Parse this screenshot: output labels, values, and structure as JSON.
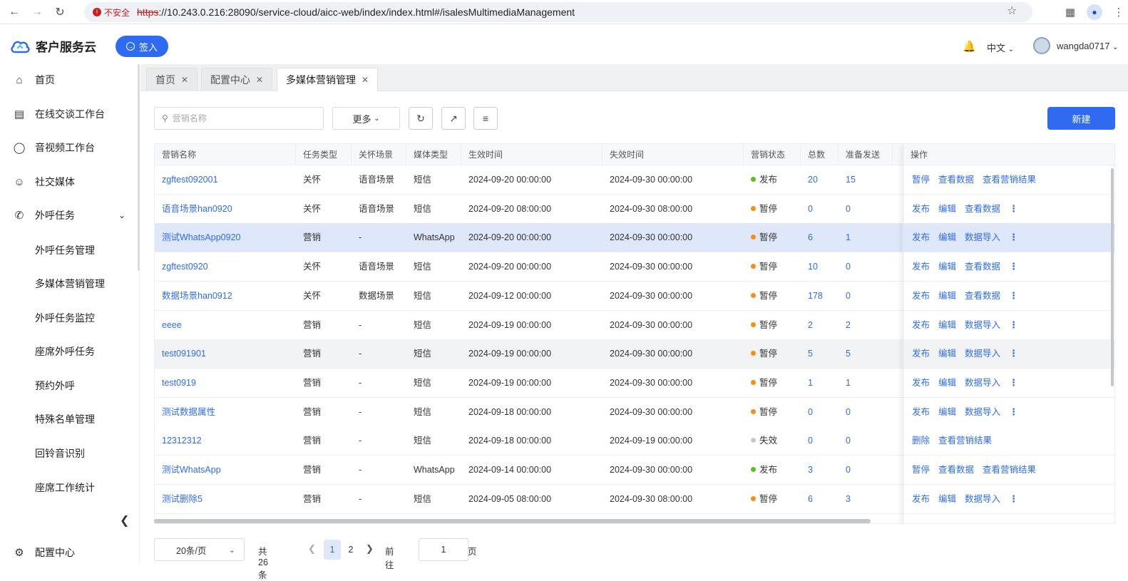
{
  "browser": {
    "insecure_label": "不安全",
    "url_scheme": "https",
    "url_rest": "://10.243.0.216:28090/service-cloud/aicc-web/index/index.html#/isalesMultimediaManagement"
  },
  "header": {
    "app_name": "客户服务云",
    "signin_label": "签入",
    "language": "中文",
    "username": "wangda0717"
  },
  "sidebar": {
    "items": [
      {
        "label": "首页",
        "icon": "home-icon"
      },
      {
        "label": "在线交谈工作台",
        "icon": "chat-icon"
      },
      {
        "label": "音视频工作台",
        "icon": "headset-icon"
      },
      {
        "label": "社交媒体",
        "icon": "social-icon"
      },
      {
        "label": "外呼任务",
        "icon": "phone-icon"
      }
    ],
    "sub_items": [
      "外呼任务管理",
      "多媒体营销管理",
      "外呼任务监控",
      "座席外呼任务",
      "预约外呼",
      "特殊名单管理",
      "回铃音识别",
      "座席工作统计"
    ],
    "bottom_item": "配置中心"
  },
  "tabs": [
    {
      "label": "首页"
    },
    {
      "label": "配置中心"
    },
    {
      "label": "多媒体营销管理"
    }
  ],
  "toolbar": {
    "search_placeholder": "营销名称",
    "more_label": "更多",
    "new_label": "新建"
  },
  "table": {
    "headers": [
      "营销名称",
      "任务类型",
      "关怀场景",
      "媒体类型",
      "生效时间",
      "失效时间",
      "营销状态",
      "总数",
      "准备发送",
      "操作"
    ],
    "rows": [
      {
        "name": "zgftest092001",
        "type": "关怀",
        "scene": "语音场景",
        "media": "短信",
        "start": "2024-09-20 00:00:00",
        "end": "2024-09-30 00:00:00",
        "status": "发布",
        "status_color": "#52c41a",
        "total": "20",
        "ready": "15",
        "ops": [
          "暂停",
          "查看数据",
          "查看营销结果"
        ],
        "more": false
      },
      {
        "name": "语音场景han0920",
        "type": "关怀",
        "scene": "语音场景",
        "media": "短信",
        "start": "2024-09-20 08:00:00",
        "end": "2024-09-30 08:00:00",
        "status": "暂停",
        "status_color": "#fa8c16",
        "total": "0",
        "ready": "0",
        "ops": [
          "发布",
          "编辑",
          "查看数据"
        ],
        "more": true
      },
      {
        "name": "测试WhatsApp0920",
        "type": "营销",
        "scene": "-",
        "media": "WhatsApp",
        "start": "2024-09-20 00:00:00",
        "end": "2024-09-30 00:00:00",
        "status": "暂停",
        "status_color": "#fa8c16",
        "total": "6",
        "ready": "1",
        "ops": [
          "发布",
          "编辑",
          "数据导入"
        ],
        "more": true
      },
      {
        "name": "zgftest0920",
        "type": "关怀",
        "scene": "语音场景",
        "media": "短信",
        "start": "2024-09-20 00:00:00",
        "end": "2024-09-30 00:00:00",
        "status": "暂停",
        "status_color": "#fa8c16",
        "total": "10",
        "ready": "0",
        "ops": [
          "发布",
          "编辑",
          "查看数据"
        ],
        "more": true
      },
      {
        "name": "数据场景han0912",
        "type": "关怀",
        "scene": "数据场景",
        "media": "短信",
        "start": "2024-09-12 00:00:00",
        "end": "2024-09-30 00:00:00",
        "status": "暂停",
        "status_color": "#fa8c16",
        "total": "178",
        "ready": "0",
        "ops": [
          "发布",
          "编辑",
          "查看数据"
        ],
        "more": true
      },
      {
        "name": "eeee",
        "type": "营销",
        "scene": "-",
        "media": "短信",
        "start": "2024-09-19 00:00:00",
        "end": "2024-09-30 00:00:00",
        "status": "暂停",
        "status_color": "#fa8c16",
        "total": "2",
        "ready": "2",
        "ops": [
          "发布",
          "编辑",
          "数据导入"
        ],
        "more": true
      },
      {
        "name": "test091901",
        "type": "营销",
        "scene": "-",
        "media": "短信",
        "start": "2024-09-19 00:00:00",
        "end": "2024-09-30 00:00:00",
        "status": "暂停",
        "status_color": "#fa8c16",
        "total": "5",
        "ready": "5",
        "ops": [
          "发布",
          "编辑",
          "数据导入"
        ],
        "more": true
      },
      {
        "name": "test0919",
        "type": "营销",
        "scene": "-",
        "media": "短信",
        "start": "2024-09-19 00:00:00",
        "end": "2024-09-30 00:00:00",
        "status": "暂停",
        "status_color": "#fa8c16",
        "total": "1",
        "ready": "1",
        "ops": [
          "发布",
          "编辑",
          "数据导入"
        ],
        "more": true
      },
      {
        "name": "测试数据属性",
        "type": "营销",
        "scene": "-",
        "media": "短信",
        "start": "2024-09-18 00:00:00",
        "end": "2024-09-30 00:00:00",
        "status": "暂停",
        "status_color": "#fa8c16",
        "total": "0",
        "ready": "0",
        "ops": [
          "发布",
          "编辑",
          "数据导入"
        ],
        "more": true
      },
      {
        "name": "12312312",
        "type": "营销",
        "scene": "-",
        "media": "短信",
        "start": "2024-09-18 00:00:00",
        "end": "2024-09-19 00:00:00",
        "status": "失效",
        "status_color": "#c8c8c8",
        "total": "0",
        "ready": "0",
        "ops": [
          "删除",
          "查看营销结果"
        ],
        "more": false
      },
      {
        "name": "测试WhatsApp",
        "type": "营销",
        "scene": "-",
        "media": "WhatsApp",
        "start": "2024-09-14 00:00:00",
        "end": "2024-09-30 00:00:00",
        "status": "发布",
        "status_color": "#52c41a",
        "total": "3",
        "ready": "0",
        "ops": [
          "暂停",
          "查看数据",
          "查看营销结果"
        ],
        "more": false
      },
      {
        "name": "测试删除5",
        "type": "营销",
        "scene": "-",
        "media": "短信",
        "start": "2024-09-05 08:00:00",
        "end": "2024-09-30 08:00:00",
        "status": "暂停",
        "status_color": "#fa8c16",
        "total": "6",
        "ready": "3",
        "ops": [
          "发布",
          "编辑",
          "数据导入"
        ],
        "more": true
      }
    ]
  },
  "pagination": {
    "page_size": "20条/页",
    "total": "共 26 条",
    "pages": [
      "1",
      "2"
    ],
    "goto_label": "前往",
    "goto_value": "1",
    "page_unit": "页"
  }
}
